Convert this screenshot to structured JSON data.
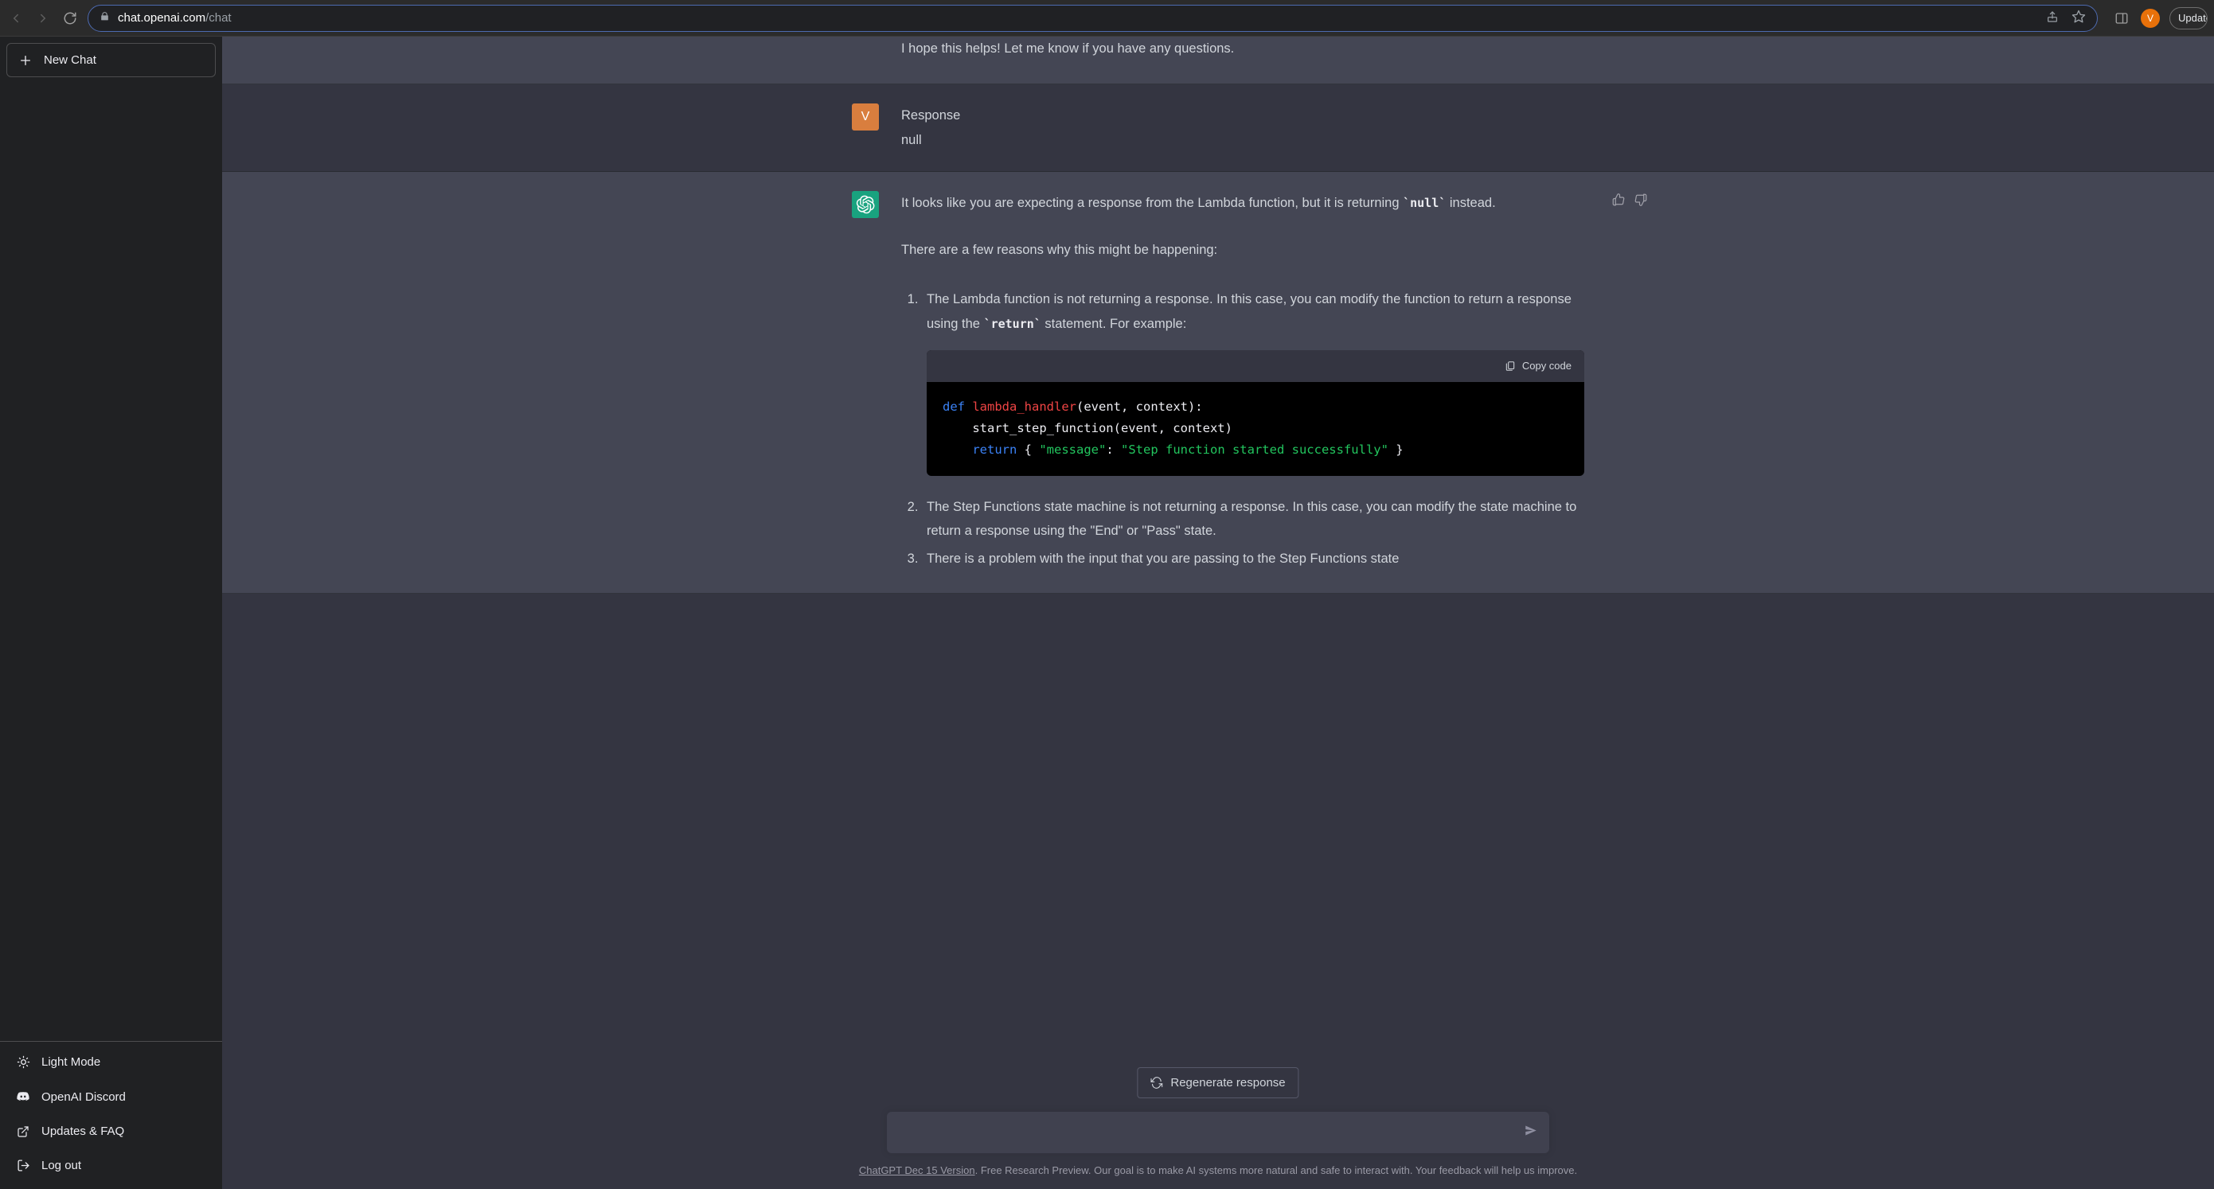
{
  "browser": {
    "url_domain": "chat.openai.com",
    "url_path": "/chat",
    "update_label": "Update",
    "avatar_initial": "V"
  },
  "sidebar": {
    "new_chat": "New Chat",
    "light_mode": "Light Mode",
    "discord": "OpenAI Discord",
    "updates_faq": "Updates & FAQ",
    "log_out": "Log out"
  },
  "messages": {
    "prev_tail": "I hope this helps! Let me know if you have any questions.",
    "user": {
      "initial": "V",
      "line1": "Response",
      "line2": "null"
    },
    "assistant": {
      "p1_a": "It looks like you are expecting a response from the Lambda function, but it is returning ",
      "p1_code": "null",
      "p1_b": " instead.",
      "p2": "There are a few reasons why this might be happening:",
      "li1_a": "The Lambda function is not returning a response. In this case, you can modify the function to return a response using the ",
      "li1_code": "return",
      "li1_b": " statement. For example:",
      "copy_label": "Copy code",
      "code": {
        "l1_kw": "def",
        "l1_fn": "lambda_handler",
        "l1_rest": "(event, context):",
        "l2": "    start_step_function(event, context)",
        "l3_indent": "    ",
        "l3_kw": "return",
        "l3_mid_a": " { ",
        "l3_str1": "\"message\"",
        "l3_mid_b": ": ",
        "l3_str2": "\"Step function started successfully\"",
        "l3_mid_c": " }"
      },
      "li2": "The Step Functions state machine is not returning a response. In this case, you can modify the state machine to return a response using the \"End\" or \"Pass\" state.",
      "li3": "There is a problem with the input that you are passing to the Step Functions state"
    }
  },
  "bottom": {
    "regenerate": "Regenerate response",
    "input_placeholder": "",
    "footer_link": "ChatGPT Dec 15 Version",
    "footer_text": ". Free Research Preview. Our goal is to make AI systems more natural and safe to interact with. Your feedback will help us improve."
  }
}
